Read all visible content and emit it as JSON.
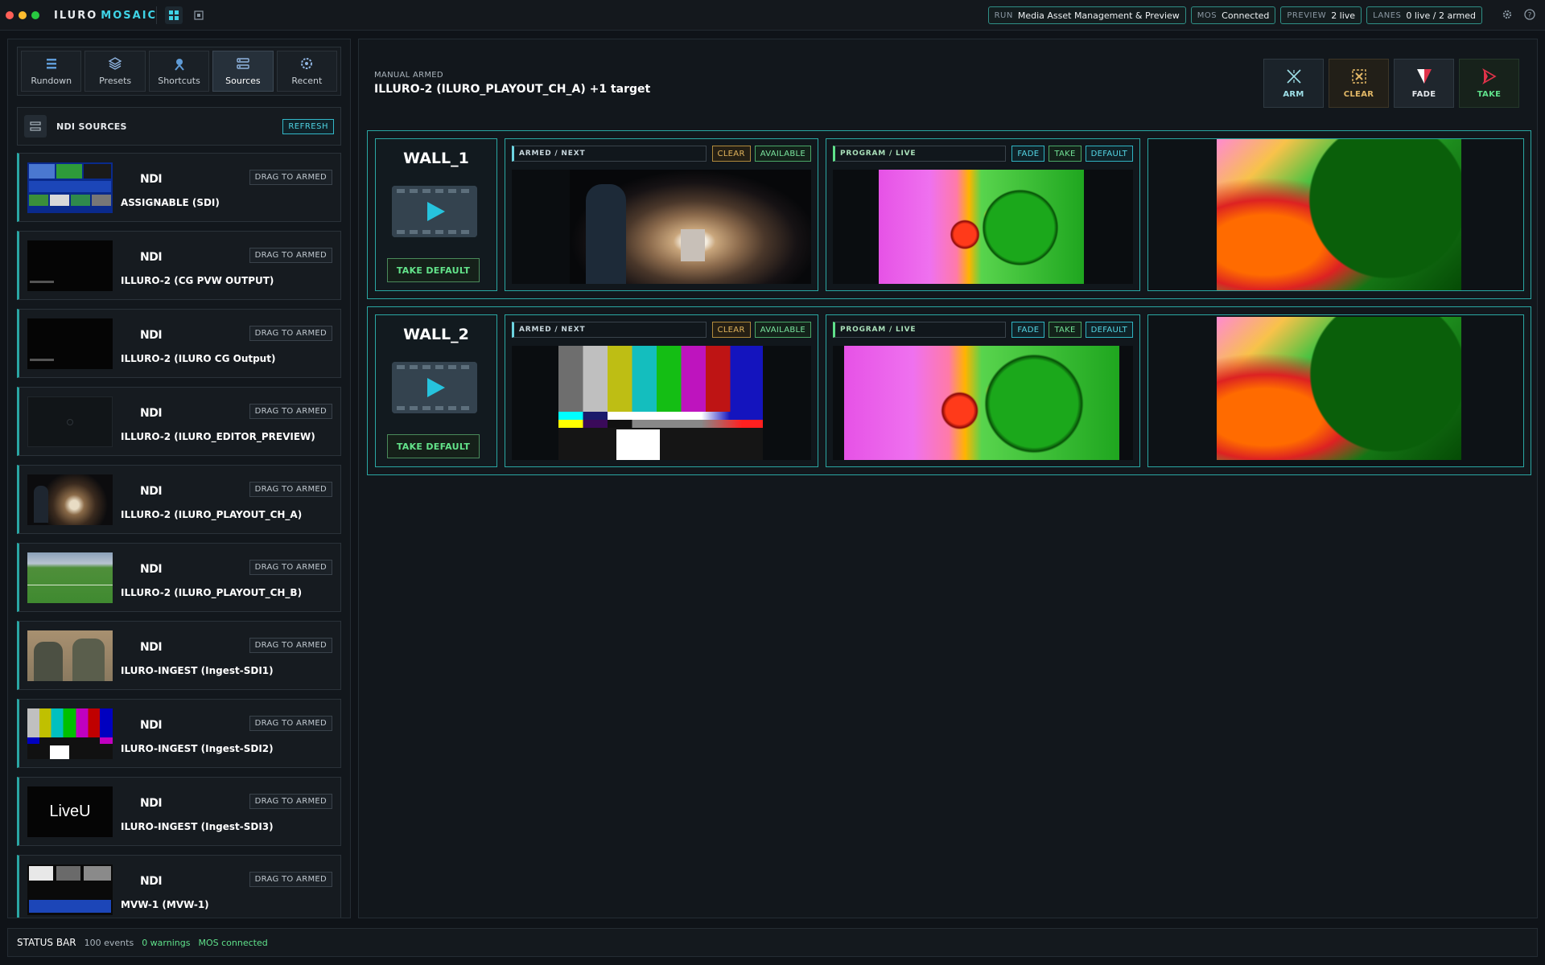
{
  "app": {
    "brand_1": "ILURO",
    "brand_2": "MOSAIC"
  },
  "header": {
    "pills": [
      {
        "key": "RUN",
        "value": "Media Asset Management & Preview"
      },
      {
        "key": "MOS",
        "value": "Connected"
      },
      {
        "key": "PREVIEW",
        "value": "2 live"
      },
      {
        "key": "LANES",
        "value": "0 live / 2 armed"
      }
    ],
    "icons": [
      "grid-icon",
      "preview-icon",
      "gear-icon",
      "help-icon"
    ]
  },
  "sidebar": {
    "tabs": [
      {
        "label": "Rundown",
        "icon": "rundown-icon"
      },
      {
        "label": "Presets",
        "icon": "presets-icon"
      },
      {
        "label": "Shortcuts",
        "icon": "shortcuts-icon"
      },
      {
        "label": "Sources",
        "icon": "sources-icon",
        "active": true
      },
      {
        "label": "Recent",
        "icon": "recent-icon"
      }
    ],
    "section_title": "NDI SOURCES",
    "refresh_label": "REFRESH",
    "ndi_label": "NDI",
    "drag_label": "DRAG TO ARMED",
    "sources": [
      {
        "name": "ASSIGNABLE (SDI)",
        "thumb": "multiview"
      },
      {
        "name": "ILLURO-2 (CG PVW OUTPUT)",
        "thumb": "black"
      },
      {
        "name": "ILLURO-2 (ILURO CG Output)",
        "thumb": "black"
      },
      {
        "name": "ILLURO-2 (ILURO_EDITOR_PREVIEW)",
        "thumb": "dark"
      },
      {
        "name": "ILLURO-2 (ILURO_PLAYOUT_CH_A)",
        "thumb": "arch"
      },
      {
        "name": "ILLURO-2 (ILURO_PLAYOUT_CH_B)",
        "thumb": "football"
      },
      {
        "name": "ILURO-INGEST (Ingest-SDI1)",
        "thumb": "people"
      },
      {
        "name": "ILURO-INGEST (Ingest-SDI2)",
        "thumb": "bars"
      },
      {
        "name": "ILURO-INGEST (Ingest-SDI3)",
        "thumb": "liveu",
        "thumb_text": "LiveU"
      },
      {
        "name": "MVW-1 (MVW-1)",
        "thumb": "multiview2"
      }
    ]
  },
  "main": {
    "mode_label": "MANUAL ARMED",
    "target_label": "ILLURO-2 (ILURO_PLAYOUT_CH_A) +1 target",
    "actions": [
      {
        "label": "ARM",
        "icon": "arm-icon"
      },
      {
        "label": "CLEAR",
        "icon": "clear-icon"
      },
      {
        "label": "FADE",
        "icon": "fade-icon"
      },
      {
        "label": "TAKE",
        "icon": "take-icon"
      }
    ],
    "walls": [
      {
        "name": "WALL_1",
        "take_default": "TAKE DEFAULT",
        "armed_title": "ARMED / NEXT",
        "armed_buttons": [
          "CLEAR",
          "AVAILABLE"
        ],
        "armed_preview": "arch",
        "program_title": "PROGRAM / LIVE",
        "program_buttons": [
          "FADE",
          "TAKE",
          "DEFAULT"
        ],
        "program_preview": "fractal",
        "output_preview": "fractal-zoom"
      },
      {
        "name": "WALL_2",
        "take_default": "TAKE DEFAULT",
        "armed_title": "ARMED / NEXT",
        "armed_buttons": [
          "CLEAR",
          "AVAILABLE"
        ],
        "armed_preview": "bars",
        "program_title": "PROGRAM / LIVE",
        "program_buttons": [
          "FADE",
          "TAKE",
          "DEFAULT"
        ],
        "program_preview": "fractal",
        "output_preview": "fractal-zoom"
      }
    ]
  },
  "status": {
    "title": "STATUS BAR",
    "events": "100 events",
    "warnings": "0 warnings",
    "mos": "MOS connected"
  },
  "colors": {
    "accent": "#3fd3e6",
    "live_green": "#5fe08a",
    "clear_amber": "#e2b45c",
    "wall_border": "#2aa7a3"
  }
}
